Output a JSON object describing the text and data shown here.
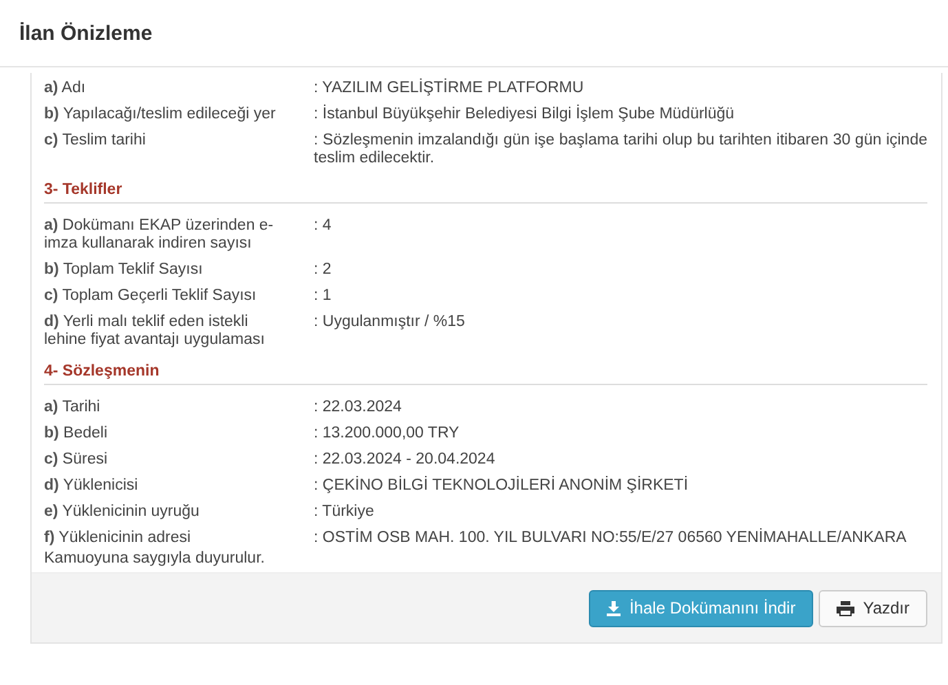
{
  "window": {
    "title": "İlan Önizleme"
  },
  "sections": [
    {
      "rows": [
        {
          "label": "**a)** Adı",
          "value": ": YAZILIM GELİŞTİRME PLATFORMU"
        },
        {
          "label": "**b)** Yapılacağı/teslim edileceği yer",
          "value": ": İstanbul Büyükşehir Belediyesi Bilgi İşlem Şube Müdürlüğü"
        },
        {
          "label": "**c)** Teslim tarihi",
          "value": ": Sözleşmenin imzalandığı gün işe başlama tarihi olup bu tarihten itibaren 30 gün içinde teslim edilecektir."
        }
      ]
    },
    {
      "heading": "3- Teklifler",
      "rows": [
        {
          "label": "**a)** Dokümanı EKAP üzerinden e-imza kullanarak indiren sayısı",
          "value": ": 4"
        },
        {
          "label": "**b)** Toplam Teklif Sayısı",
          "value": ": 2"
        },
        {
          "label": "**c)** Toplam Geçerli Teklif Sayısı",
          "value": ": 1"
        },
        {
          "label": "**d)** Yerli malı teklif eden istekli lehine fiyat avantajı uygulaması",
          "value": ": Uygulanmıştır / %15"
        }
      ]
    },
    {
      "heading": "4- Sözleşmenin",
      "rows": [
        {
          "label": "**a)** Tarihi",
          "value": ": 22.03.2024"
        },
        {
          "label": "**b)** Bedeli",
          "value": ": 13.200.000,00 TRY"
        },
        {
          "label": "**c)** Süresi",
          "value": ": 22.03.2024 - 20.04.2024"
        },
        {
          "label": "**d)** Yüklenicisi",
          "value": ": ÇEKİNO BİLGİ TEKNOLOJİLERİ ANONİM ŞİRKETİ"
        },
        {
          "label": "**e)** Yüklenicinin uyruğu",
          "value": ": Türkiye"
        },
        {
          "label": "**f)** Yüklenicinin adresi",
          "value": ": OSTİM OSB MAH. 100. YIL BULVARI NO:55/E/27 06560 YENİMAHALLE/ANKARA"
        }
      ]
    }
  ],
  "closing": "Kamuoyuna saygıyla duyurulur.",
  "buttons": [
    {
      "kind": "download",
      "label": "İhale Dokümanını İndir"
    },
    {
      "kind": "print",
      "label": "Yazdır"
    }
  ]
}
